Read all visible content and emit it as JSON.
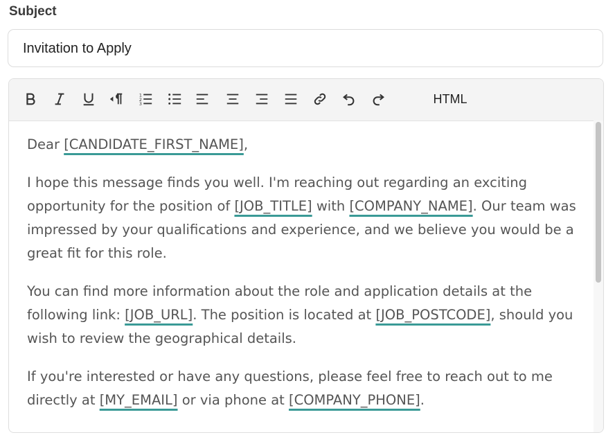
{
  "subject": {
    "label": "Subject",
    "value": "Invitation to Apply"
  },
  "toolbar": {
    "buttons": [
      {
        "name": "bold-icon"
      },
      {
        "name": "italic-icon"
      },
      {
        "name": "underline-icon"
      },
      {
        "name": "paragraph-direction-icon"
      },
      {
        "name": "ordered-list-icon"
      },
      {
        "name": "unordered-list-icon"
      },
      {
        "name": "align-left-icon"
      },
      {
        "name": "align-center-icon"
      },
      {
        "name": "align-right-icon"
      },
      {
        "name": "align-justify-icon"
      },
      {
        "name": "link-icon"
      },
      {
        "name": "undo-icon"
      },
      {
        "name": "redo-icon"
      }
    ],
    "html_label": "HTML"
  },
  "body": {
    "p1": {
      "t1": "Dear ",
      "ph1": "[CANDIDATE_FIRST_NAME]",
      "t2": ","
    },
    "p2": {
      "t1": "I hope this message finds you well. I'm reaching out regarding an exciting opportunity for the position of ",
      "ph1": "[JOB_TITLE]",
      "t2": " with ",
      "ph2": "[COMPANY_NAME]",
      "t3": ". Our team was impressed by your qualifications and experience, and we believe you would be a great fit for this role."
    },
    "p3": {
      "t1": "You can find more information about the role and application details at the following link: ",
      "ph1": "[JOB_URL]",
      "t2": ". The position is located at ",
      "ph2": "[JOB_POSTCODE]",
      "t3": ", should you wish to review the geographical details."
    },
    "p4": {
      "t1": "If you're interested or have any questions, please feel free to reach out to me directly at ",
      "ph1": "[MY_EMAIL]",
      "t2": " or via phone at ",
      "ph2": "[COMPANY_PHONE]",
      "t3": "."
    }
  },
  "colors": {
    "placeholder_underline": "#3a9a96",
    "toolbar_bg": "#f4f4f4"
  }
}
